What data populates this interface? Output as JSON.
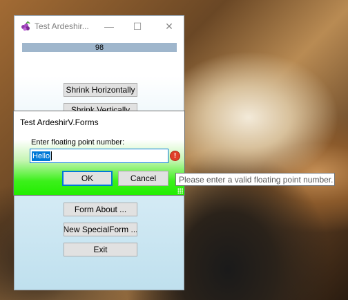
{
  "main_window": {
    "title": "Test Ardeshir...",
    "app_icon": "grapes-icon",
    "caption_buttons": {
      "minimize": "—",
      "maximize": "☐",
      "close": "✕"
    },
    "progress": {
      "value": 98,
      "label": "98",
      "color": "#9fb6cc"
    },
    "buttons": {
      "shrink_horizontally": "Shrink Horizontally",
      "shrink_vertically": "Shrink Vertically",
      "form_about": "Form About ...",
      "new_special_form": "New SpecialForm ...",
      "exit": "Exit"
    }
  },
  "dialog": {
    "title": "Test ArdeshirV.Forms",
    "prompt": "Enter floating point number:",
    "input_value": "Hello",
    "error_icon": "!",
    "ok_label": "OK",
    "cancel_label": "Cancel",
    "accent_color": "#22ee00"
  },
  "tooltip": {
    "text": "Please enter a valid floating point number."
  }
}
